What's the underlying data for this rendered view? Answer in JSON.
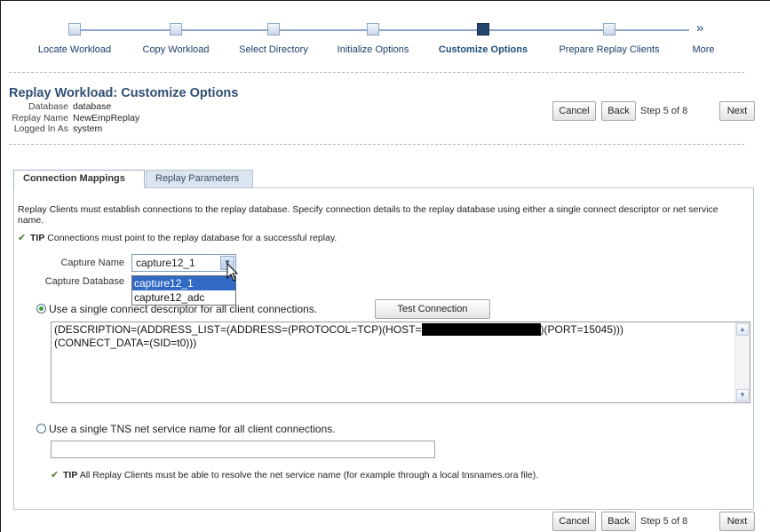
{
  "train": {
    "steps": [
      {
        "label": "Locate Workload",
        "state": "done"
      },
      {
        "label": "Copy Workload",
        "state": "done"
      },
      {
        "label": "Select Directory",
        "state": "done"
      },
      {
        "label": "Initialize Options",
        "state": "done"
      },
      {
        "label": "Customize Options",
        "state": "current"
      },
      {
        "label": "Prepare Replay Clients",
        "state": "pending"
      }
    ],
    "more_label": "More"
  },
  "header": {
    "title": "Replay Workload: Customize Options",
    "info": [
      {
        "label": "Database",
        "value": "database"
      },
      {
        "label": "Replay Name",
        "value": "NewEmpReplay"
      },
      {
        "label": "Logged In As",
        "value": "system"
      }
    ]
  },
  "nav": {
    "cancel": "Cancel",
    "back": "Back",
    "step_text": "Step 5 of 8",
    "next": "Next"
  },
  "tabs": [
    {
      "label": "Connection Mappings",
      "active": true
    },
    {
      "label": "Replay Parameters",
      "active": false
    }
  ],
  "content": {
    "description": "Replay Clients must establish connections to the replay database. Specify connection details to the replay database using either a single connect descriptor or net service name.",
    "tip1_label": "TIP",
    "tip1_text": "Connections must point to the replay database for a successful replay.",
    "capture_name_label": "Capture Name",
    "capture_name_value": "capture12_1",
    "capture_options": [
      "capture12_1",
      "capture12_adc"
    ],
    "capture_db_label": "Capture Database",
    "radio_descriptor_label": "Use a single connect descriptor for all client connections.",
    "test_connection": "Test Connection",
    "descriptor_line1_a": "(DESCRIPTION=(ADDRESS_LIST=(ADDRESS=(PROTOCOL=TCP)(HOST=",
    "descriptor_line1_b": ")(PORT=15045)))",
    "descriptor_line2": "(CONNECT_DATA=(SID=t0)))",
    "radio_tns_label": "Use a single TNS net service name for all client connections.",
    "tns_value": "",
    "tip2_label": "TIP",
    "tip2_text": "All Replay Clients must be able to resolve the net service name (for example through a local tnsnames.ora file)."
  },
  "colors": {
    "title": "#2f4f73",
    "train_current": "#22466e",
    "tab_inactive_bg": "#dbe5f0",
    "dropdown_selected": "#316ac5",
    "radio_on": "#3a9a3a"
  }
}
